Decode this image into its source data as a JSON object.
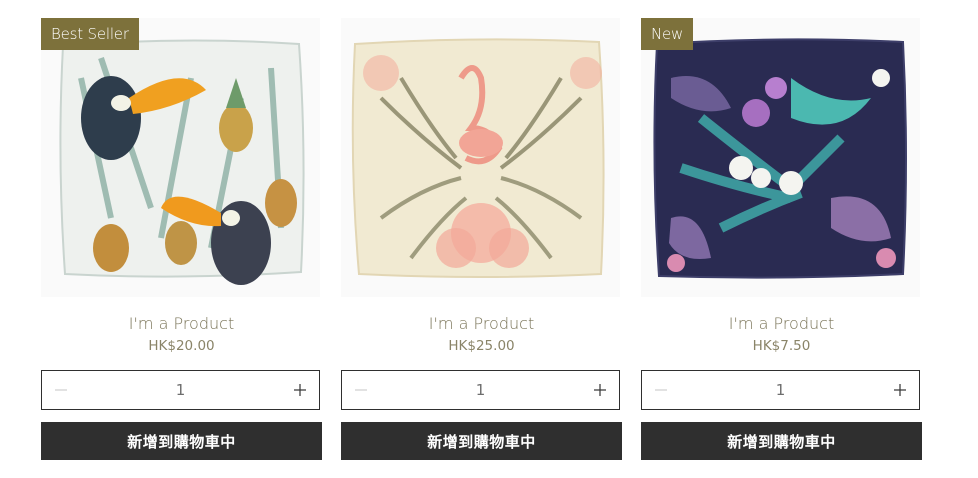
{
  "products": [
    {
      "ribbon": "Best Seller",
      "name": "I'm a Product",
      "price": "HK$20.00",
      "quantity": "1",
      "add_to_cart_label": "新增到購物車中",
      "image_icon": "toucan-pineapple-pillow-image"
    },
    {
      "ribbon": "",
      "name": "I'm a Product",
      "price": "HK$25.00",
      "quantity": "1",
      "add_to_cart_label": "新增到購物車中",
      "image_icon": "flamingo-palm-pillow-image"
    },
    {
      "ribbon": "New",
      "name": "I'm a Product",
      "price": "HK$7.50",
      "quantity": "1",
      "add_to_cart_label": "新增到購物車中",
      "image_icon": "tropical-orchid-pillow-image"
    }
  ],
  "colors": {
    "ribbon_bg": "#7d713b",
    "button_bg": "#2f2f2f",
    "text": "#7a7458"
  }
}
